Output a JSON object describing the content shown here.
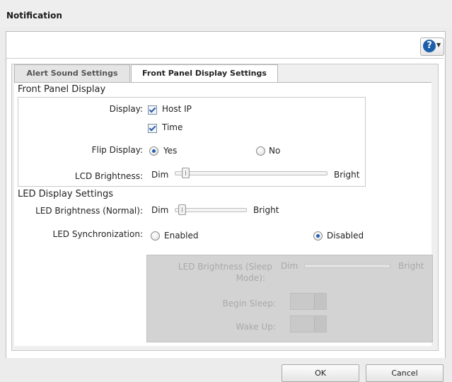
{
  "dialog": {
    "title": "Notification"
  },
  "help": {
    "icon": "help-icon",
    "glyph": "?",
    "caret": "▼"
  },
  "tabs": [
    {
      "label": "Alert Sound Settings",
      "active": false
    },
    {
      "label": "Front Panel Display Settings",
      "active": true
    }
  ],
  "front_panel": {
    "heading": "Front Panel Display",
    "display_label": "Display:",
    "display_options": [
      {
        "label": "Host IP",
        "checked": true
      },
      {
        "label": "Time",
        "checked": true
      }
    ],
    "flip_label": "Flip Display:",
    "flip_options": [
      {
        "label": "Yes",
        "selected": true
      },
      {
        "label": "No",
        "selected": false
      }
    ],
    "brightness_label": "LCD Brightness:",
    "brightness_min": "Dim",
    "brightness_max": "Bright",
    "brightness_level": 0.05
  },
  "led": {
    "heading": "LED Display Settings",
    "brightness_label": "LED Brightness (Normal):",
    "brightness_min": "Dim",
    "brightness_max": "Bright",
    "brightness_level": 0.05,
    "sync_label": "LED Synchronization:",
    "sync_options": [
      {
        "label": "Enabled",
        "selected": false
      },
      {
        "label": "Disabled",
        "selected": true
      }
    ],
    "sleep": {
      "brightness_label_1": "LED Brightness (Sleep",
      "brightness_label_2": "Mode):",
      "brightness_min": "Dim",
      "brightness_max": "Bright",
      "begin_label": "Begin Sleep:",
      "wake_label": "Wake Up:"
    }
  },
  "footer": {
    "ok": "OK",
    "cancel": "Cancel"
  },
  "colors": {
    "accent": "#1f5fb5",
    "help_bg": "#1c5eaa"
  }
}
